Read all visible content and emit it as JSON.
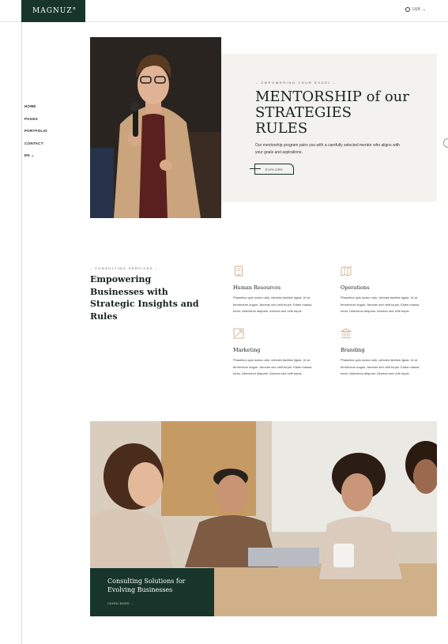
{
  "header": {
    "logo": "MAGNUZ°",
    "language": {
      "label": "LUX",
      "icon": "globe-icon"
    }
  },
  "sidenav": {
    "items": [
      {
        "label": "HOME"
      },
      {
        "label": "PAGES"
      },
      {
        "label": "PORTFOLIO"
      },
      {
        "label": "CONTACT"
      },
      {
        "label": "EN ⌄"
      }
    ]
  },
  "hero": {
    "eyebrow": "– EMPOWERING YOUR EXCEL –",
    "title_line1": "MENTORSHIP of our",
    "title_line2": "STRATEGIES",
    "title_line3": "RULES",
    "text": "Our mentorship program pairs you with a carefully selected mentor who aligns with your goals and aspirations.",
    "button_label": "EXPLORE"
  },
  "services": {
    "eyebrow": "– CONSULTING SERVICES –",
    "title": "Empowering Businesses with Strategic Insights and Rules",
    "items": [
      {
        "name": "Human Resources",
        "icon": "document-icon",
        "desc": "Phasellus quis luctus odio, ultricies facilisis ligula. Ut at fermentum augue. Aenean sed velit turpis. Etiam massa tortor, bibendum aliquam. Aenean sed velit turpis."
      },
      {
        "name": "Operations",
        "icon": "map-icon",
        "desc": "Phasellus quis luctus odio, ultricies facilisis ligula. Ut at fermentum augue. Aenean sed velit turpis. Etiam massa tortor, bibendum aliquam. Aenean sed velit turpis."
      },
      {
        "name": "Marketing",
        "icon": "growth-icon",
        "desc": "Phasellus quis luctus odio, ultricies facilisis ligula. Ut at fermentum augue. Aenean sed velit turpis. Etiam massa tortor, bibendum aliquam. Aenean sed velit turpis."
      },
      {
        "name": "Branding",
        "icon": "bank-icon",
        "desc": "Phasellus quis luctus odio, ultricies facilisis ligula. Ut at fermentum augue. Aenean sed velit turpis. Etiam massa tortor, bibendum aliquam. Aenean sed velit turpis."
      }
    ]
  },
  "consulting_card": {
    "title": "Consulting Solutions for Evolving Businesses",
    "link_label": "LEARN MORE →"
  },
  "colors": {
    "brand_dark": "#17352b",
    "accent_gold": "#c8a27a",
    "panel_bg": "#f3f2ef"
  }
}
